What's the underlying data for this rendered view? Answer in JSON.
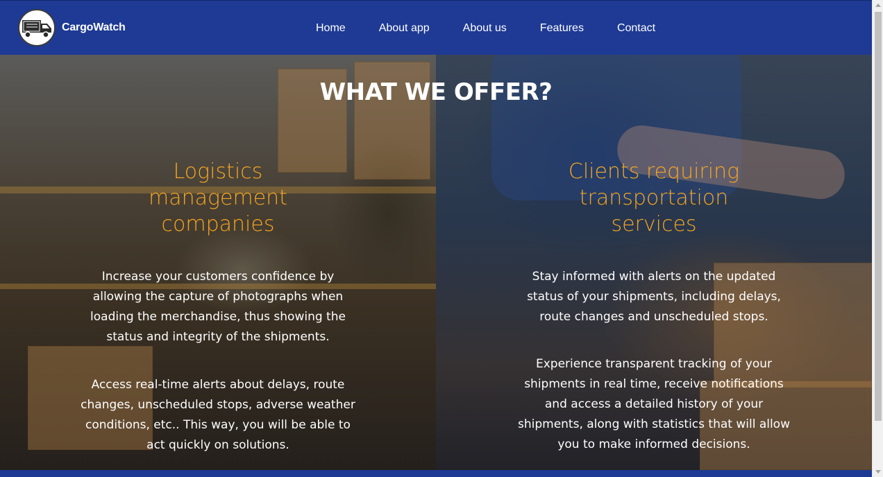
{
  "navbar": {
    "brand_name": "CargoWatch",
    "logo_icon": "delivery-truck-icon",
    "links": [
      "Home",
      "About app",
      "About us",
      "Features",
      "Contact"
    ]
  },
  "hero": {
    "title": "WHAT WE OFFER?",
    "left": {
      "heading": "Logistics management companies",
      "paragraphs": [
        "Increase your customers confidence by allowing the capture of photographs when loading the merchandise, thus showing the status and integrity of the shipments.",
        "Access real-time alerts about delays, route changes, unscheduled stops, adverse weather conditions, etc.. This way, you will be able to act quickly on solutions."
      ]
    },
    "right": {
      "heading": "Clients requiring transportation services",
      "paragraphs": [
        "Stay informed with alerts on the updated status of your shipments, including delays, route changes and unscheduled stops.",
        "Experience transparent tracking of your shipments in real time, receive notifications and access a detailed history of your shipments, along with statistics that will allow you to make informed decisions."
      ]
    }
  },
  "colors": {
    "navbar_bg": "#1e3a94",
    "heading_accent": "#f5a623",
    "text": "#ffffff"
  }
}
